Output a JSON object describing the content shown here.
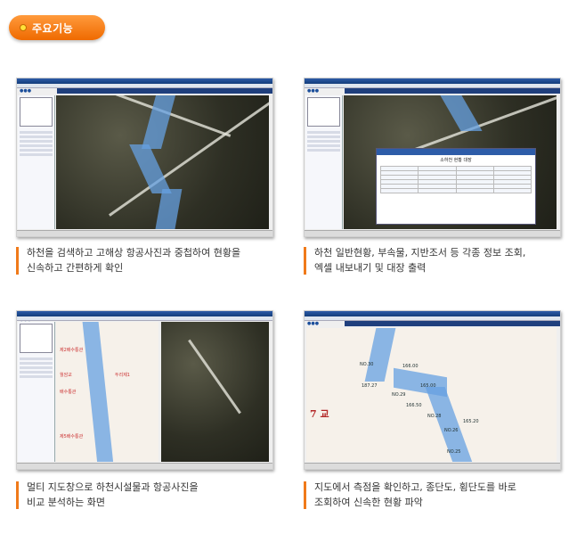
{
  "section_badge": {
    "label": "주요기능"
  },
  "panels": [
    {
      "caption_line1": "하천을 검색하고 고해상 항공사진과 중첩하여 현황을",
      "caption_line2": "신속하고 간편하게 확인"
    },
    {
      "caption_line1": "하천 일반현황, 부속물, 지반조서 등 각종 정보 조회,",
      "caption_line2": "엑셀 내보내기 및 대장 출력"
    },
    {
      "caption_line1": "멀티 지도창으로 하천시설물과 항공사진을",
      "caption_line2": "비교 분석하는 화면"
    },
    {
      "caption_line1": "지도에서 측점을 확인하고, 종단도, 횡단도를 바로",
      "caption_line2": "조회하여 신속한 현황 파악"
    }
  ],
  "screens": {
    "dialog_title": "소하천 현황 대장",
    "map_labels": {
      "left": [
        "제2배수통관",
        "월암교",
        "배수통관",
        "제5배수통관"
      ],
      "right": [
        "두리제1"
      ],
      "vector": [
        "NO.30",
        "NO.29",
        "NO.28",
        "NO.26",
        "NO.25",
        "166.00",
        "187.27",
        "165.00",
        "166.50",
        "165.20"
      ],
      "big_label": "7 교"
    }
  }
}
